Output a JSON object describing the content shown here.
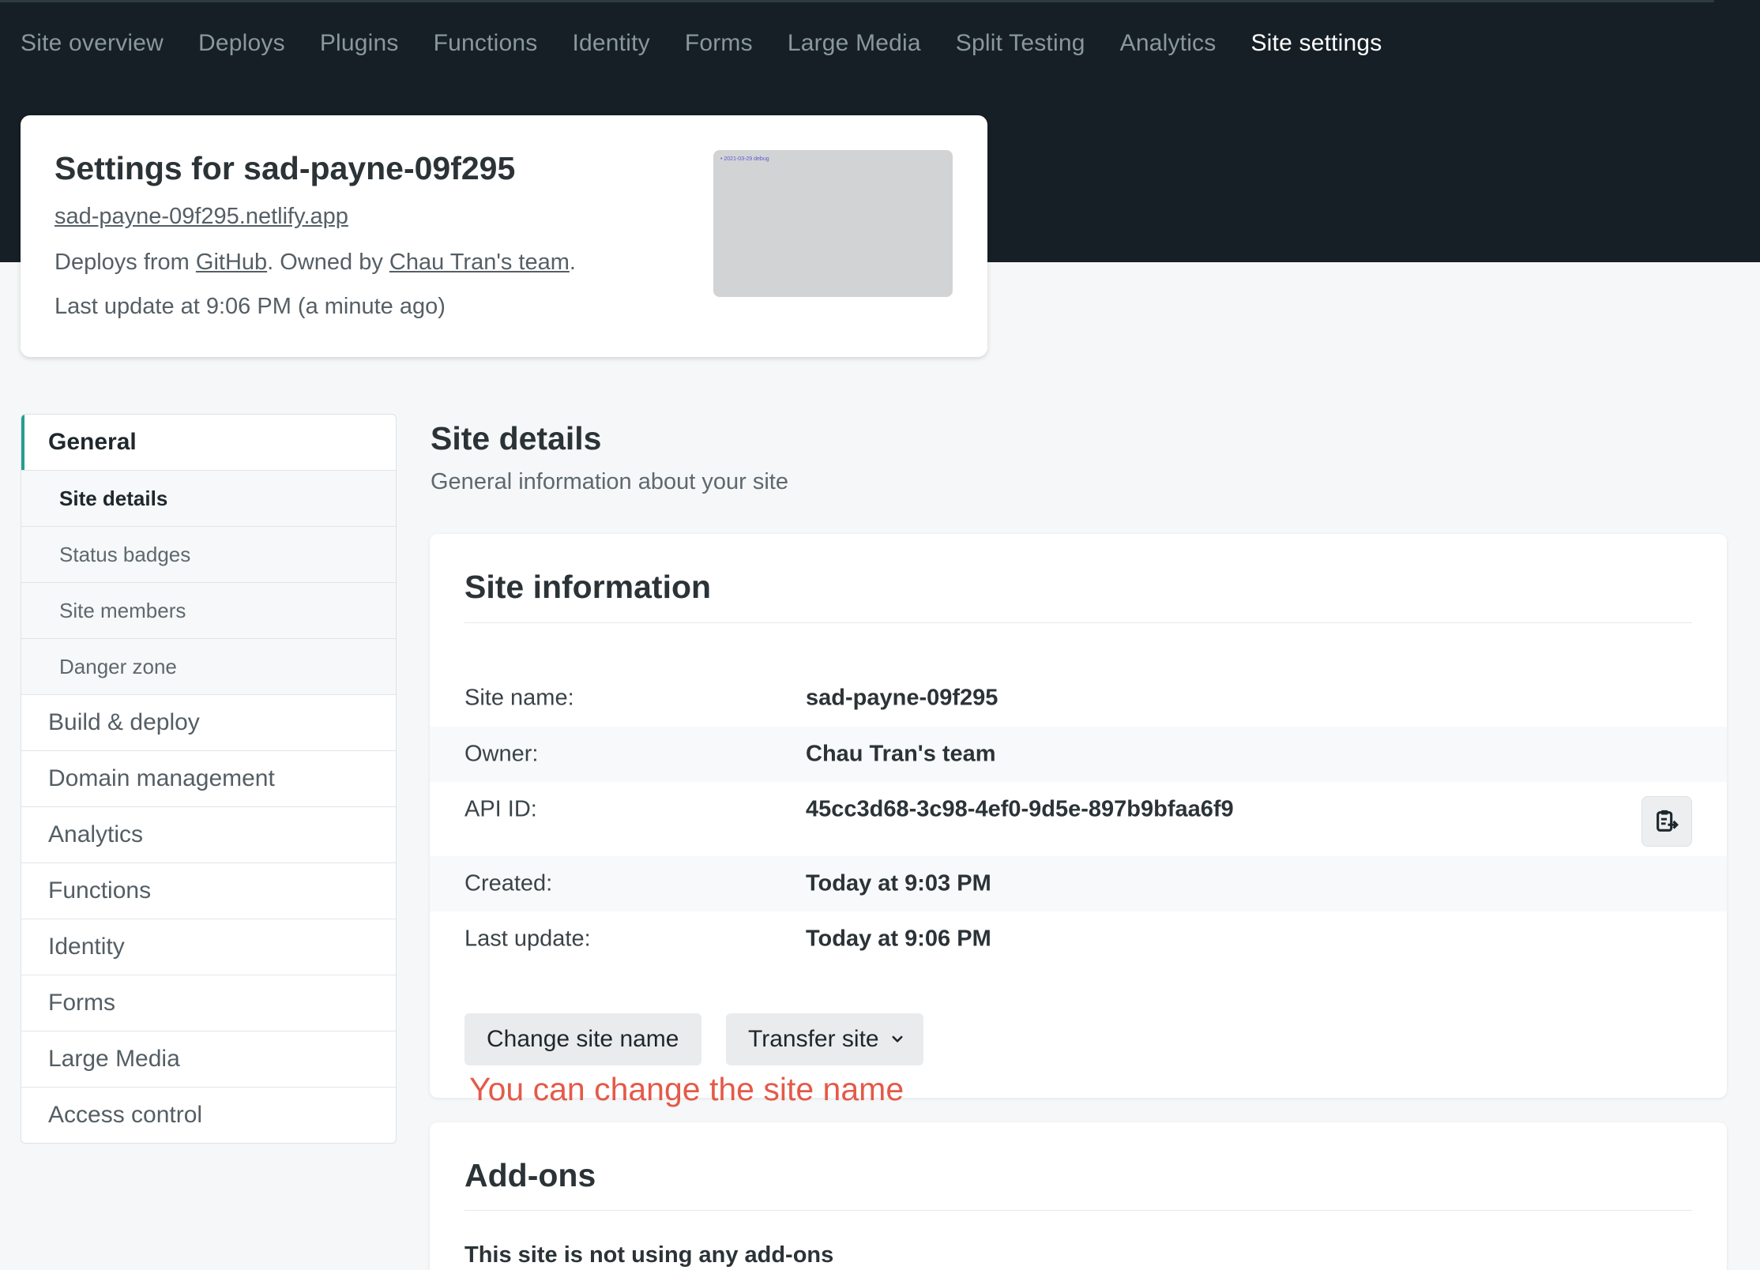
{
  "nav": {
    "items": [
      "Site overview",
      "Deploys",
      "Plugins",
      "Functions",
      "Identity",
      "Forms",
      "Large Media",
      "Split Testing",
      "Analytics",
      "Site settings"
    ],
    "active": "Site settings"
  },
  "header": {
    "title": "Settings for sad-payne-09f295",
    "url": "sad-payne-09f295.netlify.app",
    "deploys_prefix": "Deploys from ",
    "deploys_link": "GitHub",
    "owned_prefix": ". Owned by ",
    "owned_link": "Chau Tran's team",
    "owned_suffix": ".",
    "last_update": "Last update at 9:06 PM (a minute ago)",
    "thumbnail_text": "• 2021-03-29 debug"
  },
  "sidebar": {
    "general": "General",
    "subitems": [
      "Site details",
      "Status badges",
      "Site members",
      "Danger zone"
    ],
    "items": [
      "Build & deploy",
      "Domain management",
      "Analytics",
      "Functions",
      "Identity",
      "Forms",
      "Large Media",
      "Access control"
    ]
  },
  "main": {
    "section_title": "Site details",
    "section_subtitle": "General information about your site",
    "site_info": {
      "title": "Site information",
      "rows": [
        {
          "label": "Site name:",
          "value": "sad-payne-09f295"
        },
        {
          "label": "Owner:",
          "value": "Chau Tran's team"
        },
        {
          "label": "API ID:",
          "value": "45cc3d68-3c98-4ef0-9d5e-897b9bfaa6f9"
        },
        {
          "label": "Created:",
          "value": "Today at 9:03 PM"
        },
        {
          "label": "Last update:",
          "value": "Today at 9:06 PM"
        }
      ],
      "change_name_button": "Change site name",
      "transfer_button": "Transfer site"
    },
    "annotation": "You can change the site name",
    "addons": {
      "title": "Add-ons",
      "text": "This site is not using any add-ons"
    }
  },
  "colors": {
    "nav_bg": "#151f25",
    "accent": "#2a9d8f",
    "annotation": "#e45a48"
  }
}
